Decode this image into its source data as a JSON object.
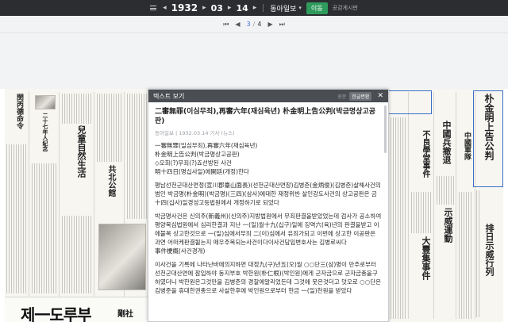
{
  "topbar": {
    "year": "1932",
    "month": "03",
    "day": "14",
    "year_unit": "",
    "paper": "동아일보",
    "move_button": "이동",
    "notice": "공감게시판"
  },
  "pagenav": {
    "current": "3",
    "total": "4",
    "sep": "/"
  },
  "viewer": {
    "title": "텍스트 보기",
    "original_label": "원문",
    "convert_label": "한글변환",
    "article_title": "二審無罪(이심무죄),再審六年(재심육년) 朴金明上告公判(박금명상고공판)",
    "meta": "동아일보 | 1932.03.14 기사 (뉴스)",
    "para1": "一審無罪(일심무죄),再審六年(재심육년)\n朴金明上告公判(박금명상고공판)\n◇오회(?)무죄(?)죠선방된 사건\n明十四日(명십사일)에開廷(개정)한다",
    "para2": "평남선천군대산면정(宣川郡臺山面長)(선천군대산면장)김병준(金炳俊)(김병준)살해사건의 범인 박금명(朴金明)(박금명)(三四)(삼사)에대한 재정위반 살인강도사건의 상고공판은 금十四(십사)일경성고등법원에서 개정하기로 되었다",
    "para3": "박금명사건은 신의주(新義州)(신의주)지방법원에서 무죄판결을받았었는데 검사가 공소하여 평양복심법원에서 심리한결과 지난 一(일)월十九(십구)일에 징역六(육)년의 판결을받고 이에불복 상고한것으로 一(일)심에서무죄 二(이)심에서 유죄가되고 이번에 상고한 이공판은 과연 어떠케판결될는지 매우주목되는사건이다이사건담임변호사는 김병로씨다\n事件梗概(사건경개)",
    "para4": "이사건을 기록에 나타난바에의지하면 대정九(구)년五(오)월 ○○단三(삼)명이 만주로부터 선천군대산면에 잠입하야 동지부호 박한원(朴仁根)(박인원)에게 군자금으로 군자금총을구하였더니 박한원은그것만을 김병준의 경찰에알리었든데 그것에 뭇은것더고 덧오로 ○○단은 김병준을 휴대한권총으로 사살한후에 박인원으로부터 현금 一(일)천원을 받았다"
  },
  "paper_texts": {
    "l1": "閔丙德命令",
    "l2": "二十七年人紀念",
    "l3": "兒童自然生活",
    "l4": "共北公館",
    "r1": "朴金明上告公判",
    "r2": "中國兵撤退",
    "r3": "不良學堂事件",
    "r4": "中國軍隊",
    "r5": "示威運動",
    "r6": "大豐集事件",
    "r7": "排日示威行列",
    "ad_big": "제一도루부",
    "ad_small": "剛社"
  }
}
